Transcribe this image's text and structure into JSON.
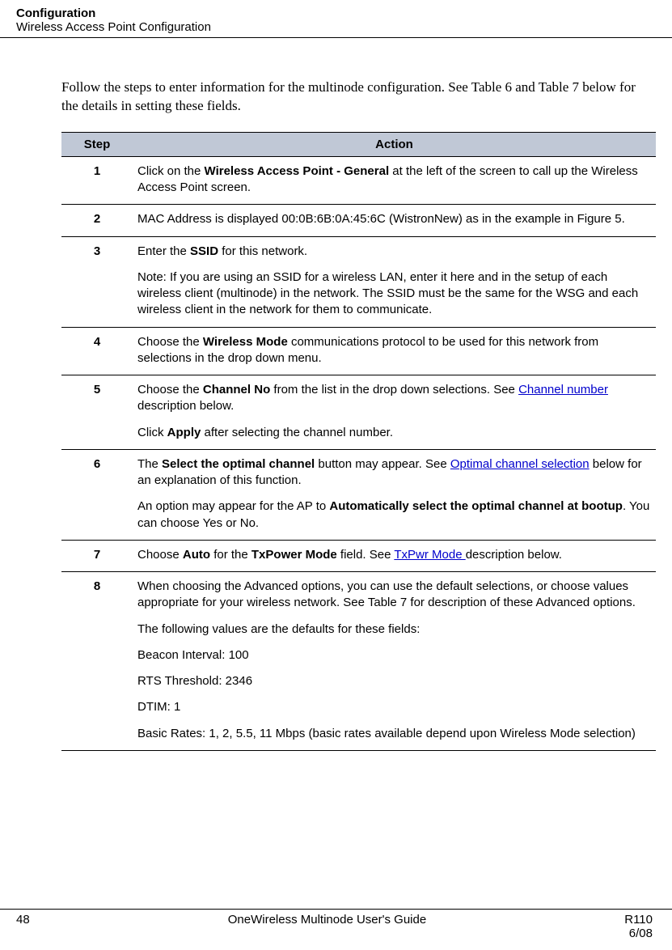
{
  "header": {
    "title": "Configuration",
    "subtitle": "Wireless Access Point Configuration"
  },
  "intro": "Follow the steps to enter information for the multinode configuration.  See Table 6 and Table 7 below for the details in setting these fields.",
  "table_header": {
    "step": "Step",
    "action": "Action"
  },
  "steps": [
    {
      "num": "1",
      "action_pre": "Click on the ",
      "bold1": "Wireless Access Point - General",
      "action_post": " at the left of the screen to call up the Wireless Access Point screen."
    },
    {
      "num": "2",
      "text": "MAC Address is displayed 00:0B:6B:0A:45:6C (WistronNew) as in the example in Figure 5."
    },
    {
      "num": "3",
      "p1_pre": "Enter the ",
      "p1_bold": "SSID",
      "p1_post": " for this network.",
      "p2": "Note:  If you are using an SSID for a wireless LAN, enter it here and in the setup of each wireless client (multinode) in the network. The SSID must be the same for the WSG and each wireless client in the network for them to communicate."
    },
    {
      "num": "4",
      "pre": "Choose the ",
      "bold": "Wireless Mode",
      "post": " communications protocol to be used for this network from selections in the drop down menu."
    },
    {
      "num": "5",
      "p1_pre": "Choose the ",
      "p1_bold": "Channel No",
      "p1_mid": " from the list in the drop down selections.  See ",
      "p1_link": "Channel number ",
      "p1_post": "description below.",
      "p2_pre": "Click ",
      "p2_bold": "Apply",
      "p2_post": " after selecting the channel number."
    },
    {
      "num": "6",
      "p1_pre": "The ",
      "p1_bold": "Select the optimal channel",
      "p1_mid": " button may appear.  See ",
      "p1_link": "Optimal channel selection",
      "p1_post": " below for an explanation of this function.",
      "p2_pre": "An option may appear for the AP to ",
      "p2_bold": "Automatically select the optimal channel at bootup",
      "p2_post": ".  You can choose Yes or No."
    },
    {
      "num": "7",
      "pre": "Choose ",
      "bold1": "Auto",
      "mid1": " for the ",
      "bold2": "TxPower Mode",
      "mid2": " field.  See ",
      "link": "TxPwr Mode ",
      "post": "description below."
    },
    {
      "num": "8",
      "p1": "When choosing the Advanced options, you can use the default selections, or choose values appropriate for your wireless network.  See Table 7 for description of these Advanced options.",
      "p2": "The following values are the defaults for these fields:",
      "p3": "Beacon Interval:  100",
      "p4": "RTS Threshold:  2346",
      "p5": "DTIM:  1",
      "p6": "Basic Rates: 1, 2, 5.5, 11 Mbps (basic rates available depend upon Wireless Mode selection)"
    }
  ],
  "footer": {
    "page": "48",
    "center": "OneWireless Multinode User's Guide",
    "right1": "R110",
    "right2": "6/08"
  }
}
